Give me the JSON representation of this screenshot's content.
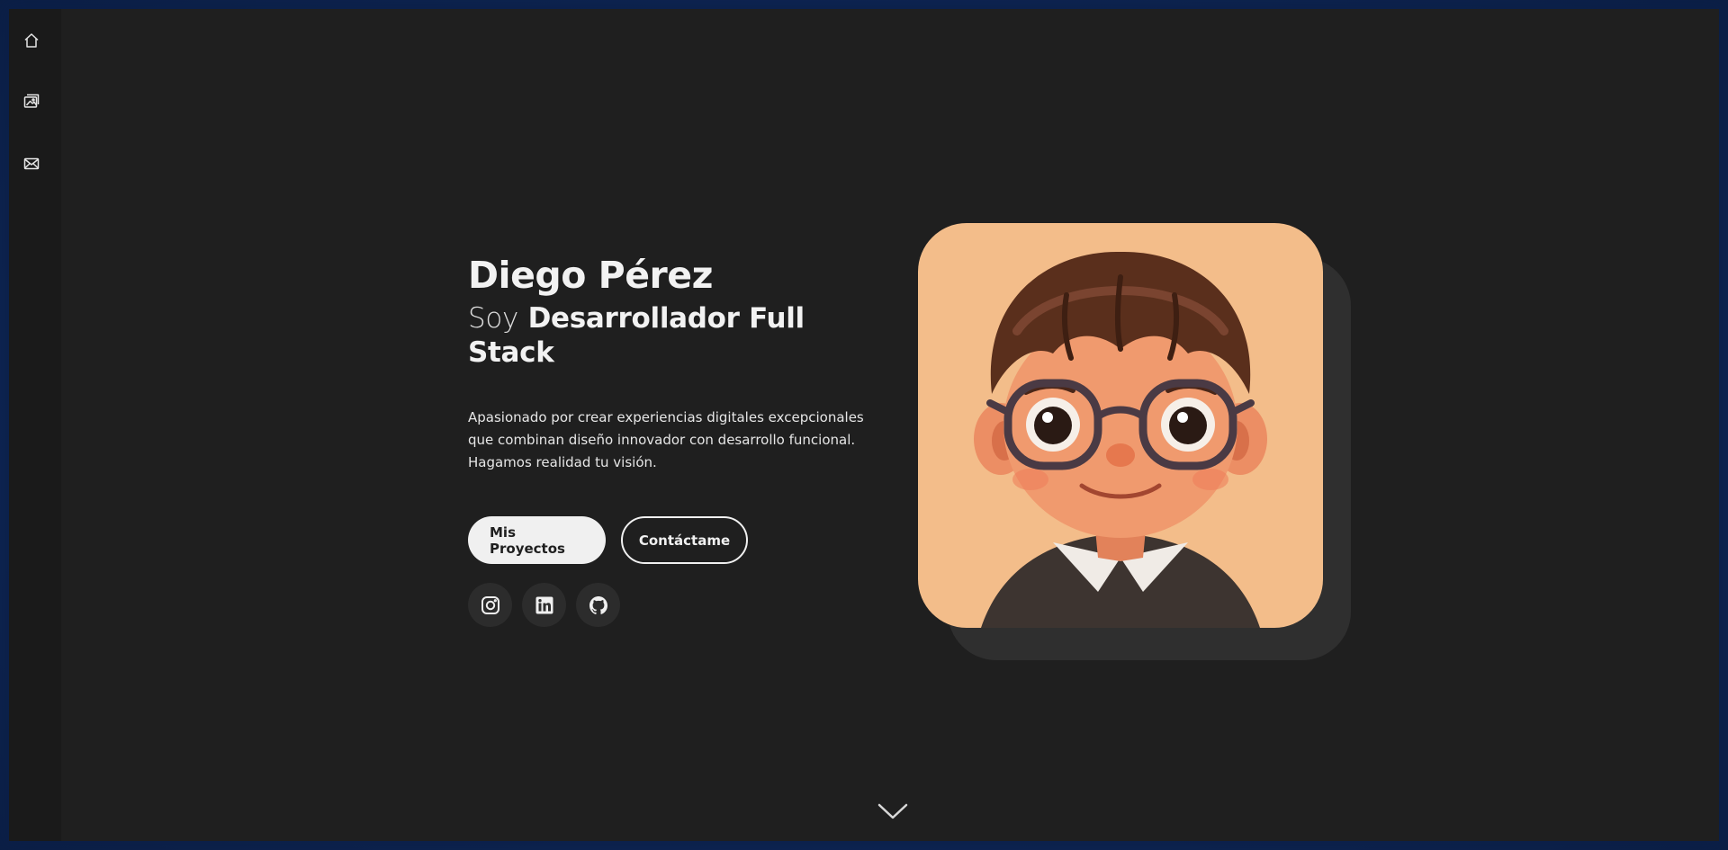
{
  "nav": {
    "items": [
      {
        "name": "home",
        "icon": "home-icon"
      },
      {
        "name": "gallery",
        "icon": "image-icon"
      },
      {
        "name": "contact",
        "icon": "mail-icon"
      }
    ]
  },
  "hero": {
    "name": "Diego Pérez",
    "role_prefix": "Soy",
    "role": "Desarrollador Full Stack",
    "description": "Apasionado por crear experiencias digitales excepcionales que combinan diseño innovador con desarrollo funcional. Hagamos realidad tu visión.",
    "primary_button": "Mis Proyectos",
    "secondary_button": "Contáctame",
    "socials": [
      {
        "name": "instagram",
        "icon": "instagram-icon"
      },
      {
        "name": "linkedin",
        "icon": "linkedin-icon"
      },
      {
        "name": "github",
        "icon": "github-icon"
      }
    ]
  },
  "avatar": {
    "alt": "3D cartoon avatar"
  },
  "scroll": {
    "icon": "chevron-down-icon"
  },
  "colors": {
    "background": "#1f1f1f",
    "sidebar": "#1a1a1a",
    "card": "#f3bd8a",
    "frame_glow": "#163a78"
  }
}
